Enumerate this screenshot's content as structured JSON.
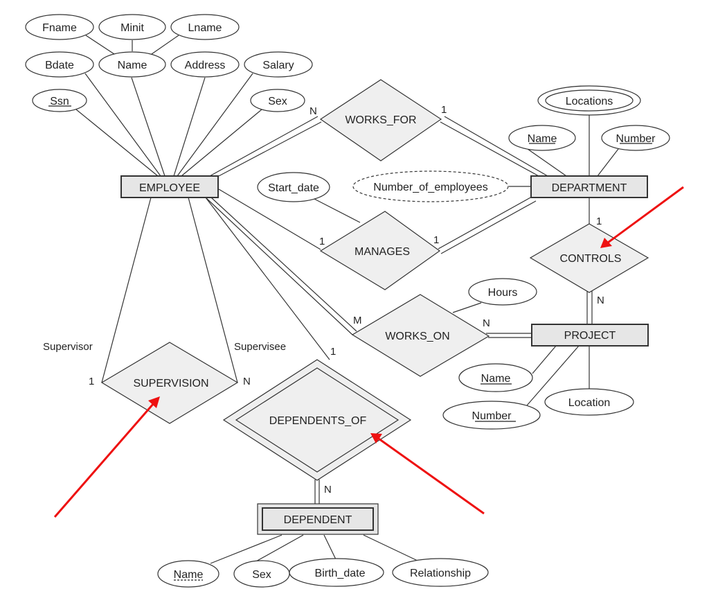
{
  "diagram": {
    "type": "ER diagram",
    "entities": {
      "employee": "EMPLOYEE",
      "department": "DEPARTMENT",
      "project": "PROJECT",
      "dependent": "DEPENDENT"
    },
    "relationships": {
      "works_for": "WORKS_FOR",
      "manages": "MANAGES",
      "works_on": "WORKS_ON",
      "controls": "CONTROLS",
      "supervision": "SUPERVISION",
      "dependents_of": "DEPENDENTS_OF"
    },
    "employee_attributes": {
      "fname": "Fname",
      "minit": "Minit",
      "lname": "Lname",
      "bdate": "Bdate",
      "name": "Name",
      "address": "Address",
      "salary": "Salary",
      "ssn": "Ssn",
      "sex": "Sex"
    },
    "department_attributes": {
      "locations": "Locations",
      "name": "Name",
      "number": "Number",
      "number_of_employees": "Number_of_employees"
    },
    "project_attributes": {
      "name": "Name",
      "number": "Number",
      "location": "Location"
    },
    "relationship_attributes": {
      "start_date": "Start_date",
      "hours": "Hours"
    },
    "dependent_attributes": {
      "name": "Name",
      "sex": "Sex",
      "birth_date": "Birth_date",
      "relationship": "Relationship"
    },
    "cardinalities": {
      "works_for_employee": "N",
      "works_for_department": "1",
      "manages_employee": "1",
      "manages_department": "1",
      "controls_department": "1",
      "controls_project": "N",
      "works_on_employee": "M",
      "works_on_project": "N",
      "supervision_supervisor": "1",
      "supervision_supervisee": "N",
      "dependents_of_employee": "1",
      "dependents_of_dependent": "N"
    },
    "roles": {
      "supervisor": "Supervisor",
      "supervisee": "Supervisee"
    },
    "annotations": {
      "arrow_color": "#ee1111",
      "arrows_point_to": [
        "CONTROLS",
        "SUPERVISION",
        "DEPENDENTS_OF"
      ]
    }
  }
}
